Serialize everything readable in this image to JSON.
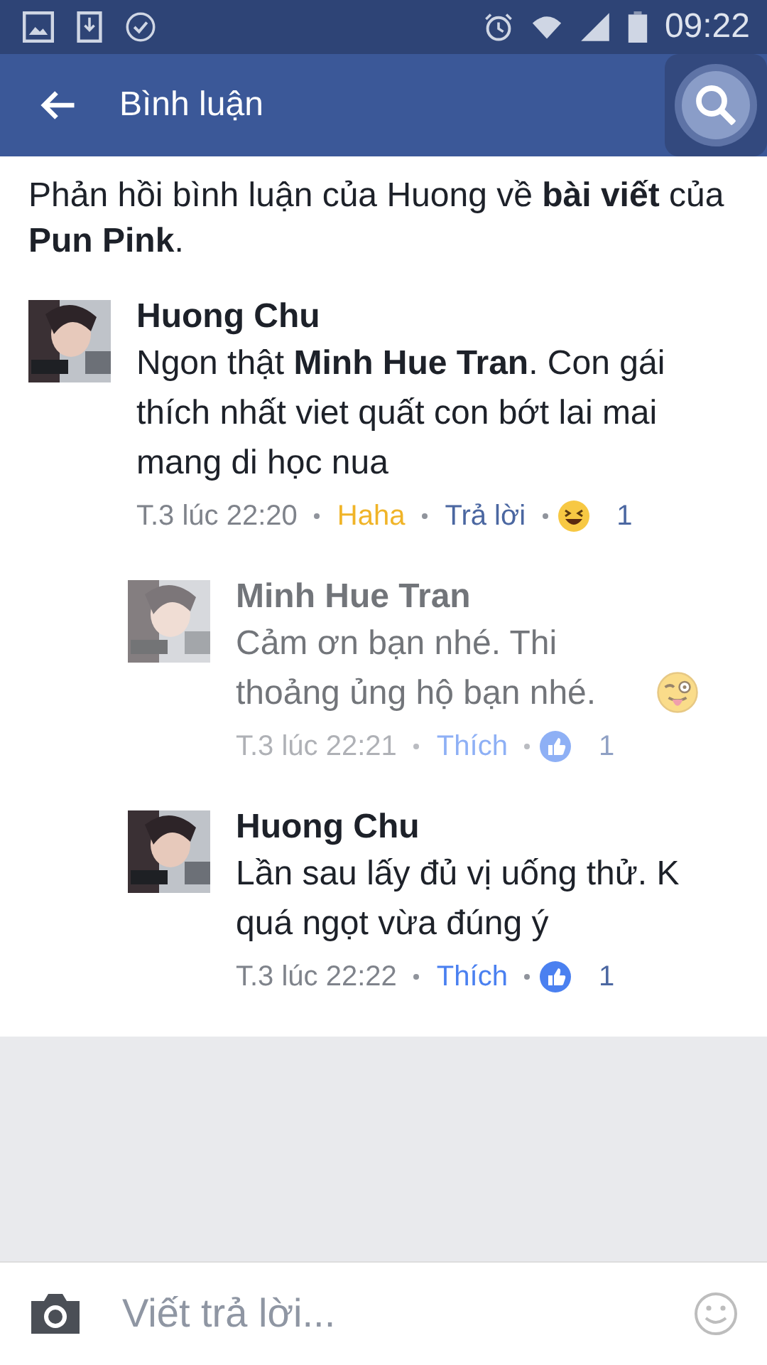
{
  "status_bar": {
    "time": "09:22"
  },
  "header": {
    "title": "Bình luận"
  },
  "intro": "Phản hồi bình luận của Huong về **bài viết** của **Pun Pink**.",
  "comments": [
    {
      "author": "Huong Chu",
      "text": "Ngon thật **Minh Hue Tran**. Con gái thích nhất viet quất con bớt lai mai mang di học nua",
      "pending": false,
      "time": "T.3 lúc 22:20",
      "action": {
        "kind": "haha",
        "label": "Haha"
      },
      "reply": "Trả lời",
      "reaction": {
        "kind": "haha",
        "count": "1"
      },
      "children": [
        {
          "author": "Minh Hue Tran",
          "text": "Cảm ơn bạn nhé. Thi thoảng ủng hộ bạn nhé.",
          "emoji": {
            "kind": "tongue"
          },
          "pending": true,
          "time": "T.3 lúc 22:21",
          "action": {
            "kind": "like",
            "label": "Thích"
          },
          "reaction": {
            "kind": "like",
            "count": "1"
          }
        },
        {
          "author": "Huong Chu",
          "text": "Lần sau lấy đủ vị uống thử. K quá ngọt vừa đúng ý",
          "pending": false,
          "time": "T.3 lúc 22:22",
          "action": {
            "kind": "like",
            "label": "Thích"
          },
          "reaction": {
            "kind": "like",
            "count": "1"
          }
        }
      ]
    }
  ],
  "composer": {
    "placeholder": "Viết trả lời..."
  }
}
